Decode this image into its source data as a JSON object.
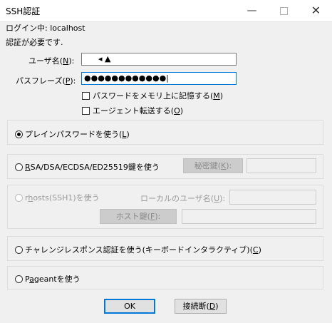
{
  "window": {
    "title": "SSH認証",
    "minimize_glyph": "—",
    "close_glyph": "✕"
  },
  "login_line": "ログイン中: localhost",
  "auth_required": "認証が必要です.",
  "username": {
    "label_pre": "ユーザ名(",
    "accel": "N",
    "label_post": "):",
    "value": "◂ ▲"
  },
  "passphrase": {
    "label_pre": "パスフレーズ(",
    "accel": "P",
    "label_post": "):",
    "value": "●●●●●●●●●●●●|"
  },
  "options": {
    "remember_pre": "パスワードをメモリ上に記憶する(",
    "remember_accel": "M",
    "remember_post": ")",
    "forward_pre": "エージェント転送する(",
    "forward_accel": "O",
    "forward_post": ")"
  },
  "methods": {
    "plain_pre": "プレインパスワードを使う(",
    "plain_accel": "L",
    "plain_post": ")",
    "rsa_pre": "",
    "rsa_accel": "R",
    "rsa_post": "SA/DSA/ECDSA/ED25519鍵を使う",
    "secret_key_button_pre": "秘密鍵(",
    "secret_key_button_accel": "K",
    "secret_key_button_post": "):",
    "rhosts_pre": "r",
    "rhosts_accel": "h",
    "rhosts_post": "osts(SSH1)を使う",
    "local_user_pre": "ローカルのユーザ名(",
    "local_user_accel": "U",
    "local_user_post": "):",
    "host_key_button_pre": "ホスト鍵(",
    "host_key_button_accel": "F",
    "host_key_button_post": "):",
    "challenge_pre": "チャレンジレスポンス認証を使う(キーボードインタラクティブ)(",
    "challenge_accel": "C",
    "challenge_post": ")",
    "pageant_pre": "P",
    "pageant_accel": "a",
    "pageant_post": "geantを使う"
  },
  "buttons": {
    "ok": "OK",
    "disconnect_pre": "接続断(",
    "disconnect_accel": "D",
    "disconnect_post": ")"
  }
}
